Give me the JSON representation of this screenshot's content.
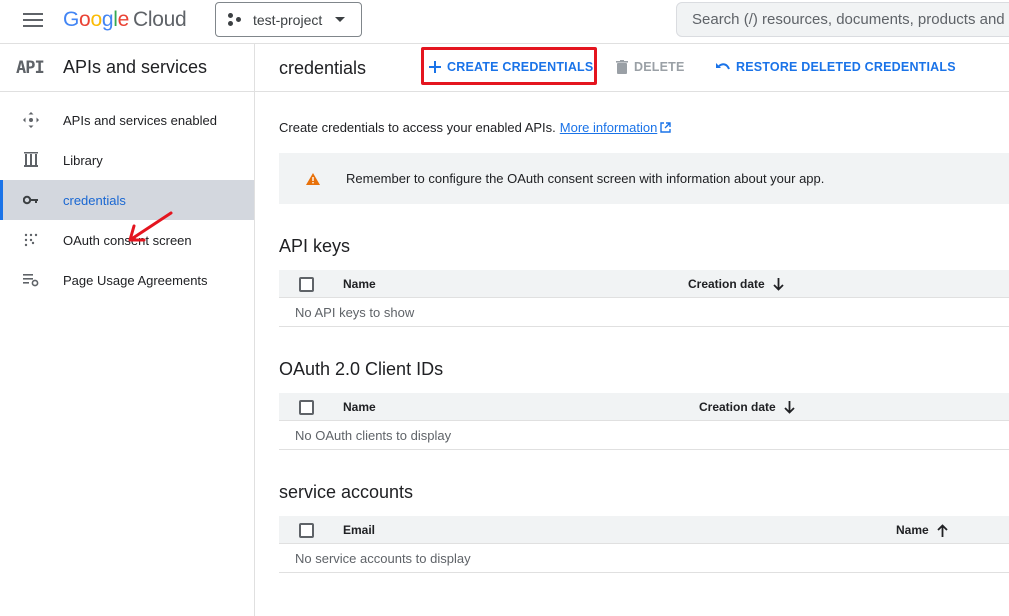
{
  "topbar": {
    "logo": {
      "g": "G",
      "o1": "o",
      "o2": "o",
      "g2": "g",
      "l": "l",
      "e": "e",
      "cloud": "Cloud"
    },
    "project": "test-project",
    "search_placeholder": "Search (/) resources, documents, products and more"
  },
  "sidebar": {
    "mark": "API",
    "title": "APIs and services",
    "items": [
      {
        "label": "APIs and services enabled",
        "icon": "apis-enabled-icon"
      },
      {
        "label": "Library",
        "icon": "library-icon"
      },
      {
        "label": "credentials",
        "icon": "key-icon",
        "active": true
      },
      {
        "label": "OAuth consent screen",
        "icon": "oauth-consent-icon"
      },
      {
        "label": "Page Usage Agreements",
        "icon": "agreements-icon"
      }
    ]
  },
  "main": {
    "title": "credentials",
    "actions": {
      "create": "CREATE CREDENTIALS",
      "delete": "DELETE",
      "restore": "RESTORE DELETED CREDENTIALS"
    },
    "intro_text": "Create credentials to access your enabled APIs.",
    "intro_link": "More information",
    "banner": "Remember to configure the OAuth consent screen with information about your app.",
    "api_keys": {
      "title": "API keys",
      "col_name": "Name",
      "col_date": "Creation date",
      "empty": "No API keys to show"
    },
    "oauth": {
      "title": "OAuth 2.0 Client IDs",
      "col_name": "Name",
      "col_date": "Creation date",
      "empty": "No OAuth clients to display"
    },
    "service_accounts": {
      "title": "service accounts",
      "col_email": "Email",
      "col_name": "Name",
      "empty": "No service accounts to display"
    }
  },
  "colors": {
    "accent": "#1a73e8",
    "highlight": "#e4151f",
    "warning": "#e8710a"
  }
}
